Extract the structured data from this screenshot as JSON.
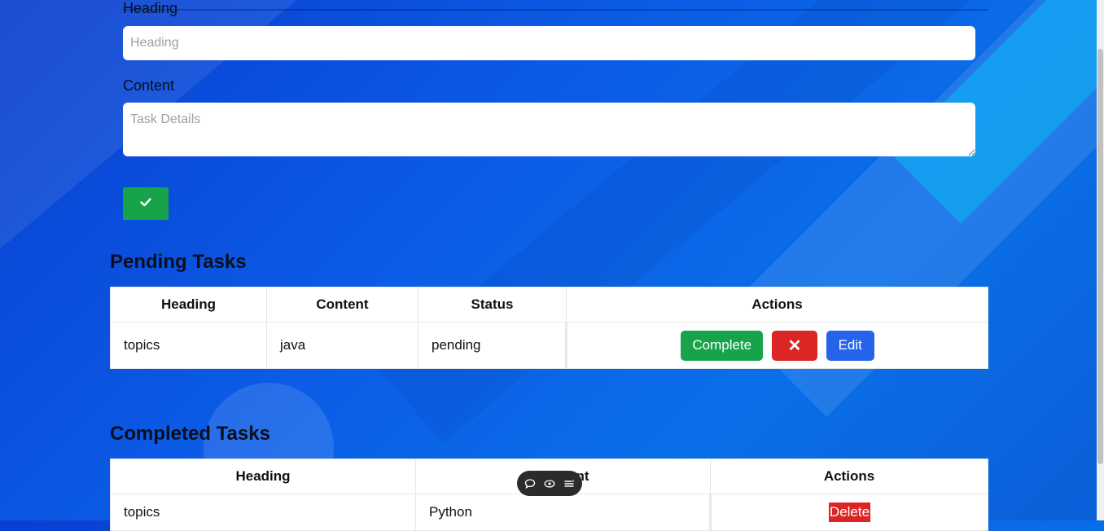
{
  "form": {
    "heading_label": "Heading",
    "heading_placeholder": "Heading",
    "heading_value": "",
    "content_label": "Content",
    "content_placeholder": "Task Details",
    "content_value": ""
  },
  "pending": {
    "title": "Pending Tasks",
    "columns": [
      "Heading",
      "Content",
      "Status",
      "Actions"
    ],
    "rows": [
      {
        "heading": "topics",
        "content": "java",
        "status": "pending"
      }
    ],
    "complete_label": "Complete",
    "delete_label": "✕",
    "edit_label": "Edit"
  },
  "completed": {
    "title": "Completed Tasks",
    "columns": [
      "Heading",
      "Content",
      "Actions"
    ],
    "rows": [
      {
        "heading": "topics",
        "content": "Python"
      }
    ],
    "delete_label": "Delete"
  },
  "colors": {
    "accent_green": "#16a34a",
    "danger_red": "#dc2626",
    "primary_blue": "#2563eb"
  },
  "icons": {
    "submit": "check-icon",
    "toolbar": [
      "comment-icon",
      "eye-icon",
      "list-icon"
    ]
  }
}
